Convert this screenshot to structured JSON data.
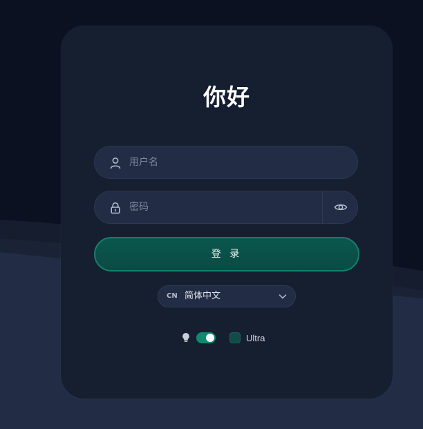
{
  "login": {
    "title": "你好",
    "username_placeholder": "用户名",
    "password_placeholder": "密码",
    "submit_label": "登 录"
  },
  "language": {
    "code": "CN",
    "selected": "简体中文"
  },
  "options": {
    "theme_toggle_on": true,
    "ultra_label": "Ultra"
  },
  "icons": {
    "username": "user-icon",
    "password": "lock-icon",
    "reveal": "eye-icon",
    "language_dropdown": "chevron-down-icon",
    "theme": "lightbulb-icon"
  },
  "colors": {
    "background": "#0c1220",
    "card": "#161f30",
    "field": "#222c44",
    "accent": "#0f8a70",
    "button": "#0a574d"
  }
}
